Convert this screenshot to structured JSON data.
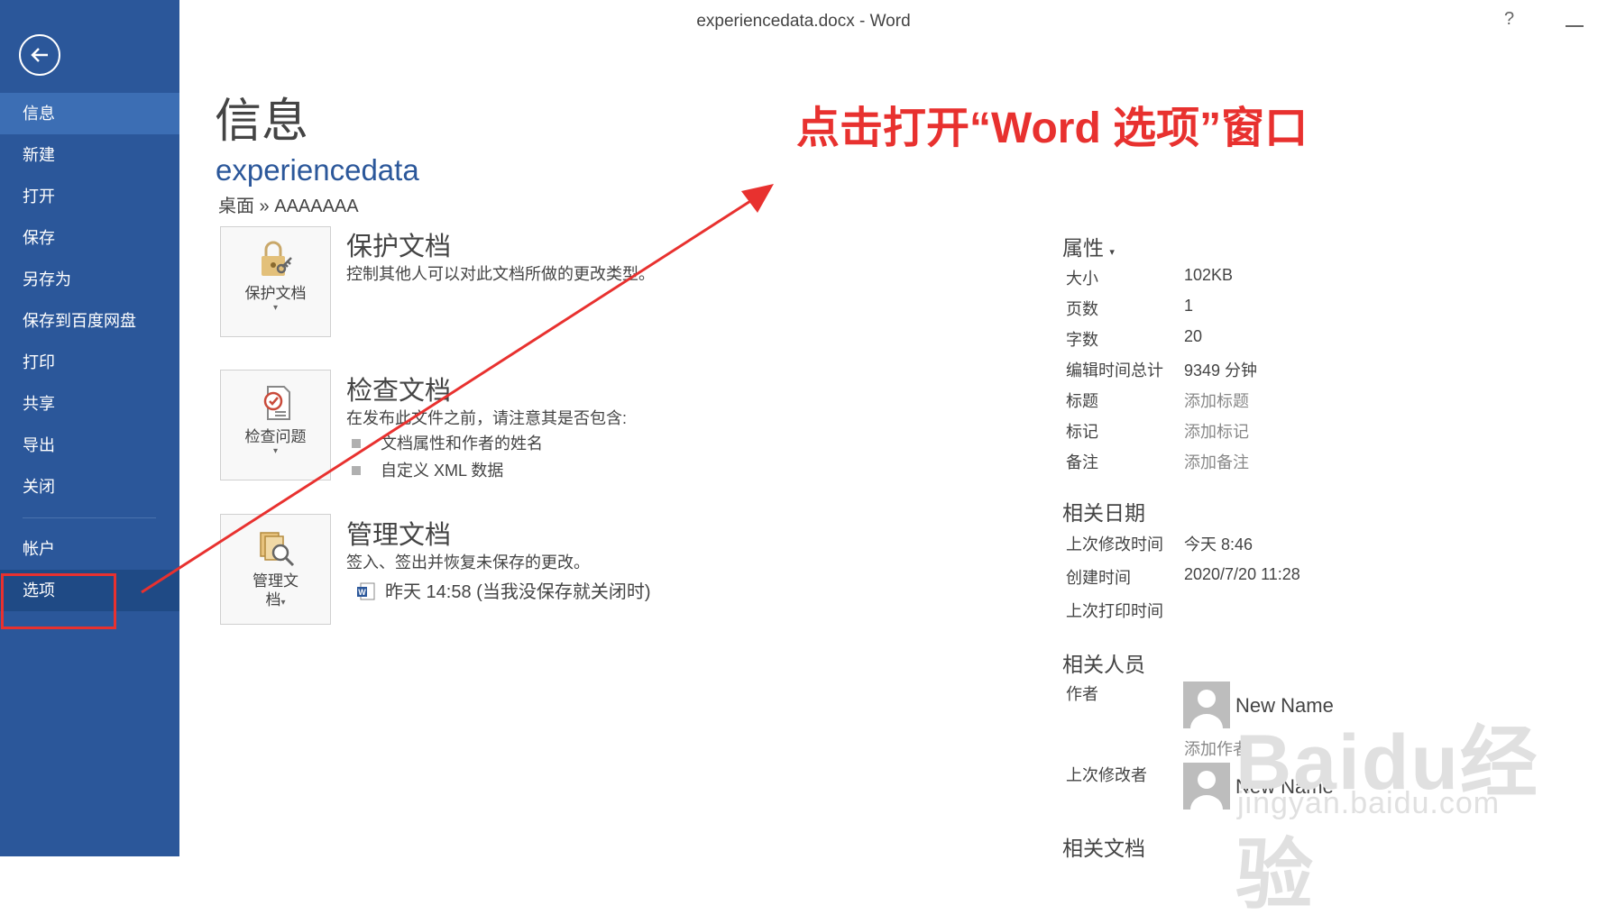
{
  "window": {
    "title": "experiencedata.docx - Word",
    "help": "?"
  },
  "sidebar": {
    "items": [
      {
        "label": "信息",
        "active": true
      },
      {
        "label": "新建"
      },
      {
        "label": "打开"
      },
      {
        "label": "保存"
      },
      {
        "label": "另存为"
      },
      {
        "label": "保存到百度网盘"
      },
      {
        "label": "打印"
      },
      {
        "label": "共享"
      },
      {
        "label": "导出"
      },
      {
        "label": "关闭"
      },
      {
        "label": "帐户"
      },
      {
        "label": "选项"
      }
    ]
  },
  "main": {
    "title": "信息",
    "doc_name": "experiencedata",
    "doc_path": "桌面 » AAAAAAA",
    "sections": [
      {
        "button_label": "保护文档",
        "title": "保护文档",
        "desc": "控制其他人可以对此文档所做的更改类型。",
        "icon": "lock-key-icon"
      },
      {
        "button_label": "检查问题",
        "title": "检查文档",
        "desc": "在发布此文件之前，请注意其是否包含:",
        "bullets": [
          "文档属性和作者的姓名",
          "自定义 XML 数据"
        ],
        "icon": "inspect-document-icon"
      },
      {
        "button_label_1": "管理文",
        "button_label_2": "档",
        "title": "管理文档",
        "desc": "签入、签出并恢复未保存的更改。",
        "version": "昨天 14:58 (当我没保存就关闭时)",
        "icon": "manage-document-icon"
      }
    ]
  },
  "properties": {
    "head": "属性",
    "rows": [
      {
        "key": "大小",
        "value": "102KB"
      },
      {
        "key": "页数",
        "value": "1"
      },
      {
        "key": "字数",
        "value": "20"
      },
      {
        "key": "编辑时间总计",
        "value": "9349 分钟"
      },
      {
        "key": "标题",
        "value": "添加标题",
        "placeholder": true
      },
      {
        "key": "标记",
        "value": "添加标记",
        "placeholder": true
      },
      {
        "key": "备注",
        "value": "添加备注",
        "placeholder": true
      }
    ],
    "dates_head": "相关日期",
    "dates": [
      {
        "key": "上次修改时间",
        "value": "今天 8:46"
      },
      {
        "key": "创建时间",
        "value": "2020/7/20 11:28"
      },
      {
        "key": "上次打印时间",
        "value": ""
      }
    ],
    "people_head": "相关人员",
    "author_key": "作者",
    "author_name": "New Name",
    "add_author": "添加作者",
    "last_modified_by_key": "上次修改者",
    "last_modified_name": "New Name",
    "related_docs_head": "相关文档"
  },
  "annotation": {
    "text": "点击打开“Word 选项”窗口",
    "color": "#e8312f"
  },
  "watermark": {
    "brand": "Baidu经验",
    "url": "jingyan.baidu.com"
  },
  "colors": {
    "sidebar": "#2b579a",
    "active": "#3c6eb4",
    "accent": "#2b579a"
  }
}
